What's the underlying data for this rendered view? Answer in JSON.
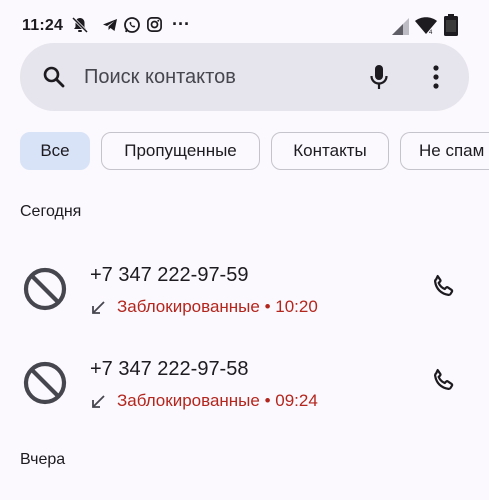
{
  "status_bar": {
    "time": "11:24",
    "left_icons": [
      "muted-notification-icon",
      "telegram-icon",
      "whatsapp-icon",
      "instagram-icon",
      "more-notifications-icon"
    ],
    "more_symbol": "···",
    "right_icons": [
      "signal-icon",
      "wifi-icon",
      "battery-icon"
    ]
  },
  "search": {
    "placeholder": "Поиск контактов"
  },
  "filters": [
    {
      "label": "Все",
      "selected": true
    },
    {
      "label": "Пропущенные",
      "selected": false
    },
    {
      "label": "Контакты",
      "selected": false
    },
    {
      "label": "Не спам",
      "selected": false
    }
  ],
  "sections": [
    {
      "title": "Сегодня",
      "calls": [
        {
          "number": "+7 347 222-97-59",
          "status": "Заблокированные",
          "separator": " • ",
          "time": "10:20"
        },
        {
          "number": "+7 347 222-97-58",
          "status": "Заблокированные",
          "separator": " • ",
          "time": "09:24"
        }
      ]
    },
    {
      "title": "Вчера",
      "calls": []
    }
  ],
  "colors": {
    "background": "#fbf9fd",
    "search_bg": "#e6e4ec",
    "chip_selected": "#d9e3f8",
    "blocked_text": "#b3261e",
    "icon": "#46464f"
  }
}
